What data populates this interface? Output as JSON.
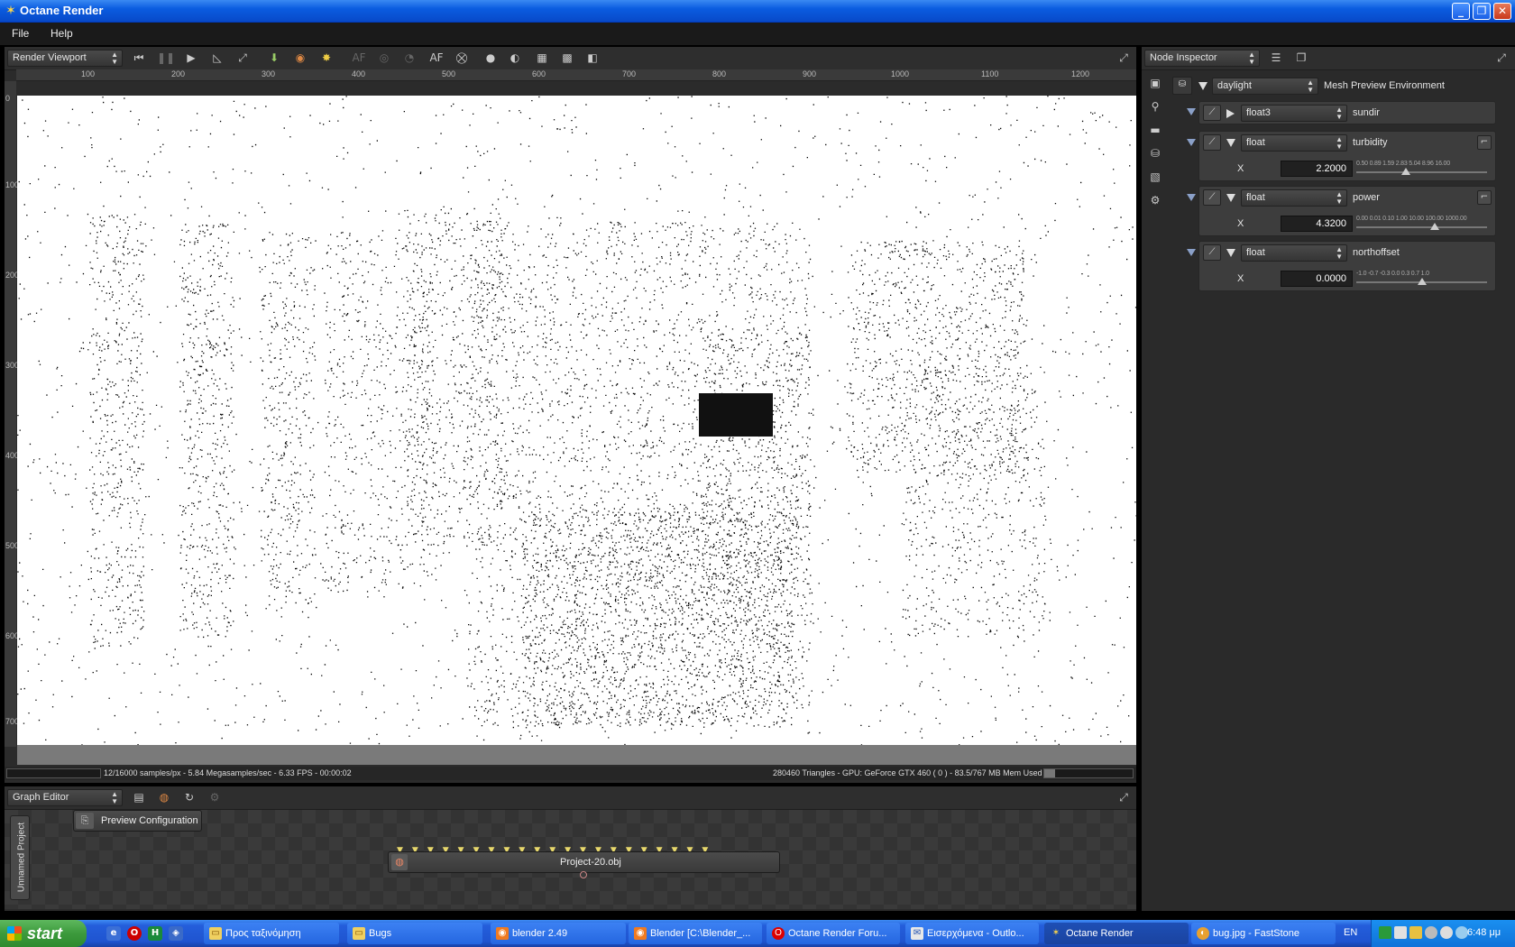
{
  "window": {
    "title": "Octane Render"
  },
  "menu": {
    "items": [
      "File",
      "Help"
    ]
  },
  "viewport_toolbar": {
    "combo": "Render Viewport"
  },
  "ruler": {
    "h_ticks": [
      "100",
      "200",
      "300",
      "400",
      "500",
      "600",
      "700",
      "800",
      "900",
      "1000",
      "1100",
      "1200"
    ],
    "v_ticks": [
      "0",
      "100",
      "200",
      "300",
      "400",
      "500",
      "600",
      "700"
    ]
  },
  "status": {
    "left": "12/16000 samples/px - 5.84 Megasamples/sec - 6.33 FPS - 00:00:02",
    "right": "280460 Triangles - GPU: GeForce GTX 460 ( 0 ) - 83.5/767 MB Mem Used"
  },
  "graph_editor": {
    "combo": "Graph Editor",
    "tab": "Unnamed Project",
    "nodes": {
      "preview": "Preview Configuration",
      "mesh": "Project-20.obj"
    }
  },
  "inspector": {
    "combo": "Node Inspector",
    "root": {
      "type": "daylight",
      "name": "Mesh Preview Environment"
    },
    "params": [
      {
        "type": "float3",
        "name": "sundir"
      },
      {
        "type": "float",
        "name": "turbidity",
        "axis": "X",
        "value": "2.2000",
        "scale": "0.50 0.89    1.59    2.83    5.04   8.96 16.00",
        "pos": 0.38
      },
      {
        "type": "float",
        "name": "power",
        "axis": "X",
        "value": "4.3200",
        "scale": "0.00 0.01   0.10    1.00   10.00 100.00 1000.00",
        "pos": 0.6
      },
      {
        "type": "float",
        "name": "northoffset",
        "axis": "X",
        "value": "0.0000",
        "scale": "-1.0  -0.7    -0.3    0.0    0.3     0.7   1.0",
        "pos": 0.5
      }
    ]
  },
  "taskbar": {
    "start": "start",
    "tasks": [
      {
        "label": "Προς ταξινόμηση",
        "icon": "folder-icon"
      },
      {
        "label": "Bugs",
        "icon": "folder-icon"
      },
      {
        "label": "blender 2.49",
        "icon": "blender-icon"
      },
      {
        "label": "Blender [C:\\Blender_...",
        "icon": "blender-icon"
      },
      {
        "label": "Octane Render Foru...",
        "icon": "opera-icon"
      },
      {
        "label": "Εισερχόμενα - Outlo...",
        "icon": "outlook-icon"
      },
      {
        "label": "Octane Render",
        "icon": "octane-icon"
      },
      {
        "label": "bug.jpg - FastStone",
        "icon": "faststone-icon"
      }
    ],
    "lang": "EN",
    "clock": "6:48 μμ"
  }
}
